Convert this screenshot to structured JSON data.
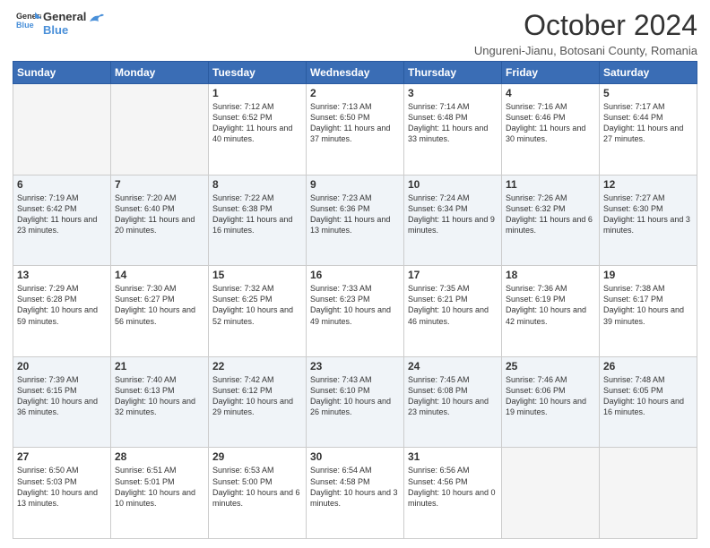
{
  "logo": {
    "line1": "General",
    "line2": "Blue"
  },
  "title": "October 2024",
  "subtitle": "Ungureni-Jianu, Botosani County, Romania",
  "days_header": [
    "Sunday",
    "Monday",
    "Tuesday",
    "Wednesday",
    "Thursday",
    "Friday",
    "Saturday"
  ],
  "weeks": [
    [
      {
        "day": "",
        "info": ""
      },
      {
        "day": "",
        "info": ""
      },
      {
        "day": "1",
        "info": "Sunrise: 7:12 AM\nSunset: 6:52 PM\nDaylight: 11 hours and 40 minutes."
      },
      {
        "day": "2",
        "info": "Sunrise: 7:13 AM\nSunset: 6:50 PM\nDaylight: 11 hours and 37 minutes."
      },
      {
        "day": "3",
        "info": "Sunrise: 7:14 AM\nSunset: 6:48 PM\nDaylight: 11 hours and 33 minutes."
      },
      {
        "day": "4",
        "info": "Sunrise: 7:16 AM\nSunset: 6:46 PM\nDaylight: 11 hours and 30 minutes."
      },
      {
        "day": "5",
        "info": "Sunrise: 7:17 AM\nSunset: 6:44 PM\nDaylight: 11 hours and 27 minutes."
      }
    ],
    [
      {
        "day": "6",
        "info": "Sunrise: 7:19 AM\nSunset: 6:42 PM\nDaylight: 11 hours and 23 minutes."
      },
      {
        "day": "7",
        "info": "Sunrise: 7:20 AM\nSunset: 6:40 PM\nDaylight: 11 hours and 20 minutes."
      },
      {
        "day": "8",
        "info": "Sunrise: 7:22 AM\nSunset: 6:38 PM\nDaylight: 11 hours and 16 minutes."
      },
      {
        "day": "9",
        "info": "Sunrise: 7:23 AM\nSunset: 6:36 PM\nDaylight: 11 hours and 13 minutes."
      },
      {
        "day": "10",
        "info": "Sunrise: 7:24 AM\nSunset: 6:34 PM\nDaylight: 11 hours and 9 minutes."
      },
      {
        "day": "11",
        "info": "Sunrise: 7:26 AM\nSunset: 6:32 PM\nDaylight: 11 hours and 6 minutes."
      },
      {
        "day": "12",
        "info": "Sunrise: 7:27 AM\nSunset: 6:30 PM\nDaylight: 11 hours and 3 minutes."
      }
    ],
    [
      {
        "day": "13",
        "info": "Sunrise: 7:29 AM\nSunset: 6:28 PM\nDaylight: 10 hours and 59 minutes."
      },
      {
        "day": "14",
        "info": "Sunrise: 7:30 AM\nSunset: 6:27 PM\nDaylight: 10 hours and 56 minutes."
      },
      {
        "day": "15",
        "info": "Sunrise: 7:32 AM\nSunset: 6:25 PM\nDaylight: 10 hours and 52 minutes."
      },
      {
        "day": "16",
        "info": "Sunrise: 7:33 AM\nSunset: 6:23 PM\nDaylight: 10 hours and 49 minutes."
      },
      {
        "day": "17",
        "info": "Sunrise: 7:35 AM\nSunset: 6:21 PM\nDaylight: 10 hours and 46 minutes."
      },
      {
        "day": "18",
        "info": "Sunrise: 7:36 AM\nSunset: 6:19 PM\nDaylight: 10 hours and 42 minutes."
      },
      {
        "day": "19",
        "info": "Sunrise: 7:38 AM\nSunset: 6:17 PM\nDaylight: 10 hours and 39 minutes."
      }
    ],
    [
      {
        "day": "20",
        "info": "Sunrise: 7:39 AM\nSunset: 6:15 PM\nDaylight: 10 hours and 36 minutes."
      },
      {
        "day": "21",
        "info": "Sunrise: 7:40 AM\nSunset: 6:13 PM\nDaylight: 10 hours and 32 minutes."
      },
      {
        "day": "22",
        "info": "Sunrise: 7:42 AM\nSunset: 6:12 PM\nDaylight: 10 hours and 29 minutes."
      },
      {
        "day": "23",
        "info": "Sunrise: 7:43 AM\nSunset: 6:10 PM\nDaylight: 10 hours and 26 minutes."
      },
      {
        "day": "24",
        "info": "Sunrise: 7:45 AM\nSunset: 6:08 PM\nDaylight: 10 hours and 23 minutes."
      },
      {
        "day": "25",
        "info": "Sunrise: 7:46 AM\nSunset: 6:06 PM\nDaylight: 10 hours and 19 minutes."
      },
      {
        "day": "26",
        "info": "Sunrise: 7:48 AM\nSunset: 6:05 PM\nDaylight: 10 hours and 16 minutes."
      }
    ],
    [
      {
        "day": "27",
        "info": "Sunrise: 6:50 AM\nSunset: 5:03 PM\nDaylight: 10 hours and 13 minutes."
      },
      {
        "day": "28",
        "info": "Sunrise: 6:51 AM\nSunset: 5:01 PM\nDaylight: 10 hours and 10 minutes."
      },
      {
        "day": "29",
        "info": "Sunrise: 6:53 AM\nSunset: 5:00 PM\nDaylight: 10 hours and 6 minutes."
      },
      {
        "day": "30",
        "info": "Sunrise: 6:54 AM\nSunset: 4:58 PM\nDaylight: 10 hours and 3 minutes."
      },
      {
        "day": "31",
        "info": "Sunrise: 6:56 AM\nSunset: 4:56 PM\nDaylight: 10 hours and 0 minutes."
      },
      {
        "day": "",
        "info": ""
      },
      {
        "day": "",
        "info": ""
      }
    ]
  ]
}
